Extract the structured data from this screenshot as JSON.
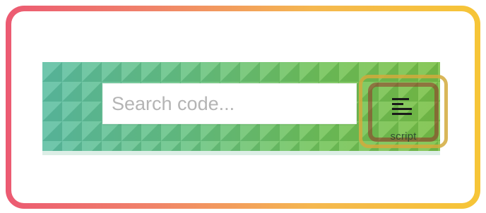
{
  "search": {
    "placeholder": "Search code...",
    "value": ""
  },
  "toolbar": {
    "script_label": "script",
    "script_icon": "list-lines-icon"
  },
  "colors": {
    "outer_frame_gradient_start": "#ec5a72",
    "outer_frame_gradient_end": "#f6c537",
    "toolbar_teal": "#5fc0a4",
    "toolbar_green": "#7bc146",
    "highlight_inner": "#963228",
    "highlight_outer": "#d2aa3c"
  }
}
